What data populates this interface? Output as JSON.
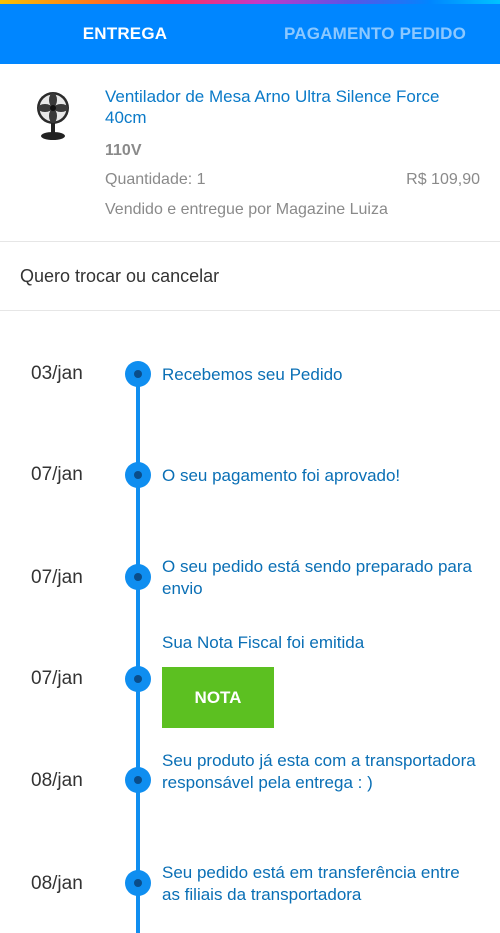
{
  "tabs": [
    {
      "label": "ENTREGA",
      "active": true
    },
    {
      "label": "PAGAMENTO PEDIDO",
      "active": false
    }
  ],
  "product": {
    "name": "Ventilador de Mesa Arno Ultra Silence Force 40cm",
    "variant": "110V",
    "quantity": "Quantidade: 1",
    "price": "R$ 109,90",
    "seller": "Vendido e entregue por Magazine Luiza",
    "image_icon": "fan-icon"
  },
  "exchange": {
    "label": "Quero trocar ou cancelar"
  },
  "timeline": [
    {
      "date": "03/jan",
      "text": "Recebemos seu Pedido"
    },
    {
      "date": "07/jan",
      "text": "O seu pagamento foi aprovado!"
    },
    {
      "date": "07/jan",
      "text": "O seu pedido está sendo preparado para envio"
    },
    {
      "date": "07/jan",
      "text": "Sua Nota Fiscal foi emitida",
      "button": "NOTA"
    },
    {
      "date": "08/jan",
      "text": "Seu produto já esta com a transportadora responsável pela entrega : )"
    },
    {
      "date": "08/jan",
      "text": "Seu pedido está em transferência entre as filiais da transportadora"
    }
  ],
  "colors": {
    "header_blue": "#0086ff",
    "timeline_blue": "#0f8ef0",
    "link_blue": "#0a6fb5",
    "nota_green": "#5cc021",
    "muted_text": "#8a8a8a"
  }
}
